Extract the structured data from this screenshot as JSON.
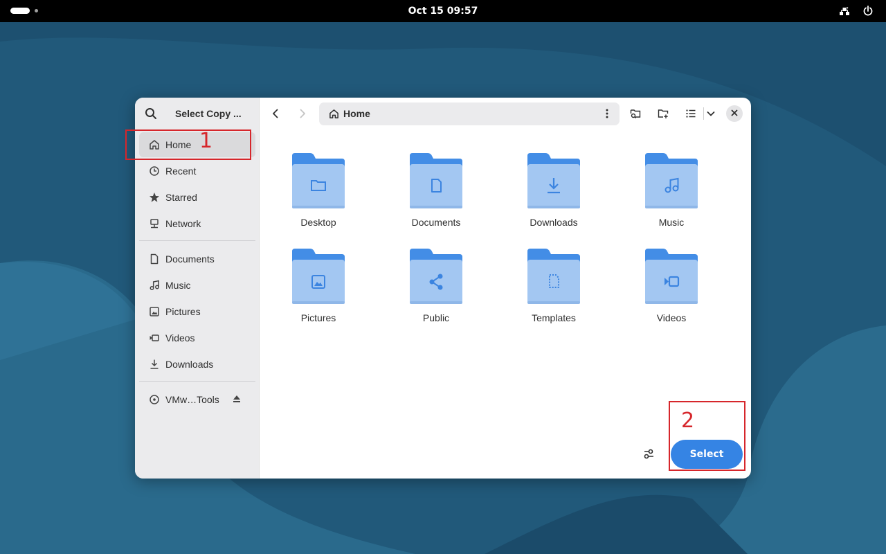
{
  "topbar": {
    "clock": "Oct 15  09:57"
  },
  "dialog": {
    "title": "Select Copy ...",
    "path_label": "Home",
    "select_label": "Select"
  },
  "sidebar": {
    "places": [
      {
        "label": "Home",
        "icon": "home-icon"
      },
      {
        "label": "Recent",
        "icon": "clock-icon"
      },
      {
        "label": "Starred",
        "icon": "star-icon"
      },
      {
        "label": "Network",
        "icon": "network-icon"
      }
    ],
    "bookmarks": [
      {
        "label": "Documents",
        "icon": "document-icon"
      },
      {
        "label": "Music",
        "icon": "music-icon"
      },
      {
        "label": "Pictures",
        "icon": "picture-icon"
      },
      {
        "label": "Videos",
        "icon": "video-icon"
      },
      {
        "label": "Downloads",
        "icon": "download-icon"
      }
    ],
    "devices": [
      {
        "label": "VMw…Tools",
        "icon": "disc-icon"
      }
    ]
  },
  "files": [
    {
      "name": "Desktop",
      "icon": "folder-desktop-icon"
    },
    {
      "name": "Documents",
      "icon": "folder-documents-icon"
    },
    {
      "name": "Downloads",
      "icon": "folder-downloads-icon"
    },
    {
      "name": "Music",
      "icon": "folder-music-icon"
    },
    {
      "name": "Pictures",
      "icon": "folder-pictures-icon"
    },
    {
      "name": "Public",
      "icon": "folder-public-icon"
    },
    {
      "name": "Templates",
      "icon": "folder-templates-icon"
    },
    {
      "name": "Videos",
      "icon": "folder-videos-icon"
    }
  ],
  "annotations": {
    "first": "1",
    "second": "2"
  },
  "colors": {
    "accent": "#3584e4",
    "folder": "#438de6",
    "folder_front": "#a3c7f2",
    "annotation": "#d6262b",
    "desktop": "#1f5676"
  }
}
